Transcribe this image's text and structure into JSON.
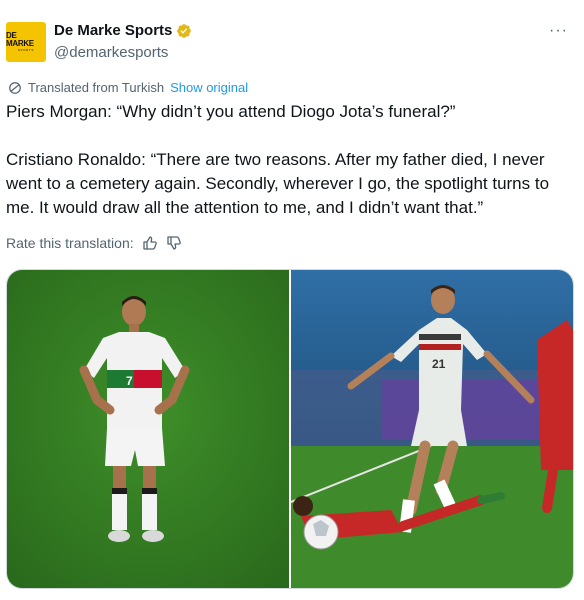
{
  "account": {
    "display_name": "De Marke Sports",
    "handle": "@demarkesports",
    "avatar_text": "DE MARKE",
    "avatar_subtext": "SPORTS",
    "avatar_color": "#f5c400"
  },
  "translation": {
    "label": "Translated from Turkish",
    "link": "Show original"
  },
  "post": {
    "paragraph1": "Piers Morgan: “Why didn’t you attend Diogo Jota’s funeral?”",
    "paragraph2": "Cristiano Ronaldo: “There are two reasons. After my father died, I never went to a cemetery again. Secondly, wherever I go, the spotlight turns to me. It would draw all the attention to me, and I didn’t want that.”"
  },
  "rate": {
    "label": "Rate this translation:"
  },
  "icons": [
    "verified-badge-icon",
    "more-options-icon",
    "translate-icon",
    "thumbs-up-icon",
    "thumbs-down-icon"
  ],
  "colors": {
    "link": "#1d9bf0",
    "secondary_text": "#536471",
    "verified_gold": "#e2b719"
  },
  "media": {
    "photo_left": "player-standing-photo",
    "left_shirt_number": "7",
    "photo_right": "player-dribbling-photo",
    "right_shirt_number": "21"
  }
}
